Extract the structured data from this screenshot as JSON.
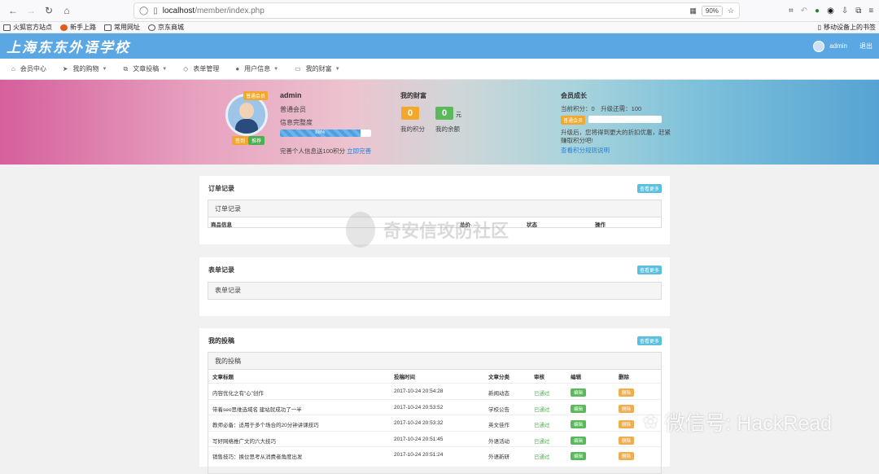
{
  "browser": {
    "url_host": "localhost",
    "url_path": "/member/index.php",
    "zoom": "90%",
    "bookmarks": [
      "火狐官方站点",
      "新手上路",
      "常用网址",
      "京东商城"
    ],
    "mobile_bookmarks": "移动设备上的书签"
  },
  "site": {
    "logo": "上海东东外语学校",
    "username": "admin",
    "logout": "退出"
  },
  "nav": [
    {
      "label": "会员中心",
      "icon": "home-icon",
      "dropdown": false
    },
    {
      "label": "我的购物",
      "icon": "send-icon",
      "dropdown": true
    },
    {
      "label": "文章投稿",
      "icon": "copy-icon",
      "dropdown": true
    },
    {
      "label": "表单管理",
      "icon": "diamond-icon",
      "dropdown": false
    },
    {
      "label": "用户信息",
      "icon": "user-icon",
      "dropdown": true
    },
    {
      "label": "我的财富",
      "icon": "card-icon",
      "dropdown": true
    }
  ],
  "profile": {
    "member_tag": "普通会员",
    "sign_label": "签到",
    "promo_label": "推荐",
    "name": "admin",
    "level": "普通会员",
    "complete_label": "信息完整度",
    "complete_percent": 88,
    "complete_text": "88%",
    "tip": "完善个人信息送100积分",
    "tip_link": "立即完善"
  },
  "wealth": {
    "title": "我的财富",
    "points": "0",
    "balance": "0",
    "unit": "元",
    "points_label": "我的积分",
    "balance_label": "我的余额"
  },
  "growth": {
    "title": "会员成长",
    "points_line": "当前积分：0　升级还需：100",
    "tag": "普通会员",
    "progress_percent": 0,
    "desc": "升级后，您将得到更大的折扣优惠，赶紧赚取积分吧!",
    "link": "查看积分规则说明"
  },
  "orders": {
    "title": "订单记录",
    "more": "查看更多",
    "inner_title": "订单记录",
    "columns": [
      "商品信息",
      "总价",
      "状态",
      "操作"
    ]
  },
  "forms": {
    "title": "表单记录",
    "more": "查看更多",
    "inner_title": "表单记录"
  },
  "posts": {
    "title": "我的投稿",
    "more": "查看更多",
    "inner_title": "我的投稿",
    "columns": [
      "文章标题",
      "投稿时间",
      "文章分类",
      "审核",
      "编辑",
      "删除"
    ],
    "edit_label": "编辑",
    "delete_label": "删除",
    "rows": [
      {
        "title": "内容优化之有“心”创作",
        "time": "2017-10-24 20:54:28",
        "category": "新闻动态",
        "status": "已通过"
      },
      {
        "title": "带着seo思维选域名 建站就成功了一半",
        "time": "2017-10-24 20:53:52",
        "category": "学校公告",
        "status": "已通过"
      },
      {
        "title": "教师必备：适用于多个场合的20分钟讲课技巧",
        "time": "2017-10-24 20:53:32",
        "category": "英文佳作",
        "status": "已通过"
      },
      {
        "title": "写好网络推广文的六大技巧",
        "time": "2017-10-24 20:51:45",
        "category": "外语活动",
        "status": "已通过"
      },
      {
        "title": "销售技巧：换位思考从消费者角度出发",
        "time": "2017-10-24 20:51:24",
        "category": "外语新研",
        "status": "已通过"
      }
    ]
  },
  "watermarks": {
    "center": "奇安信攻防社区",
    "corner": "微信号: HackRead"
  }
}
